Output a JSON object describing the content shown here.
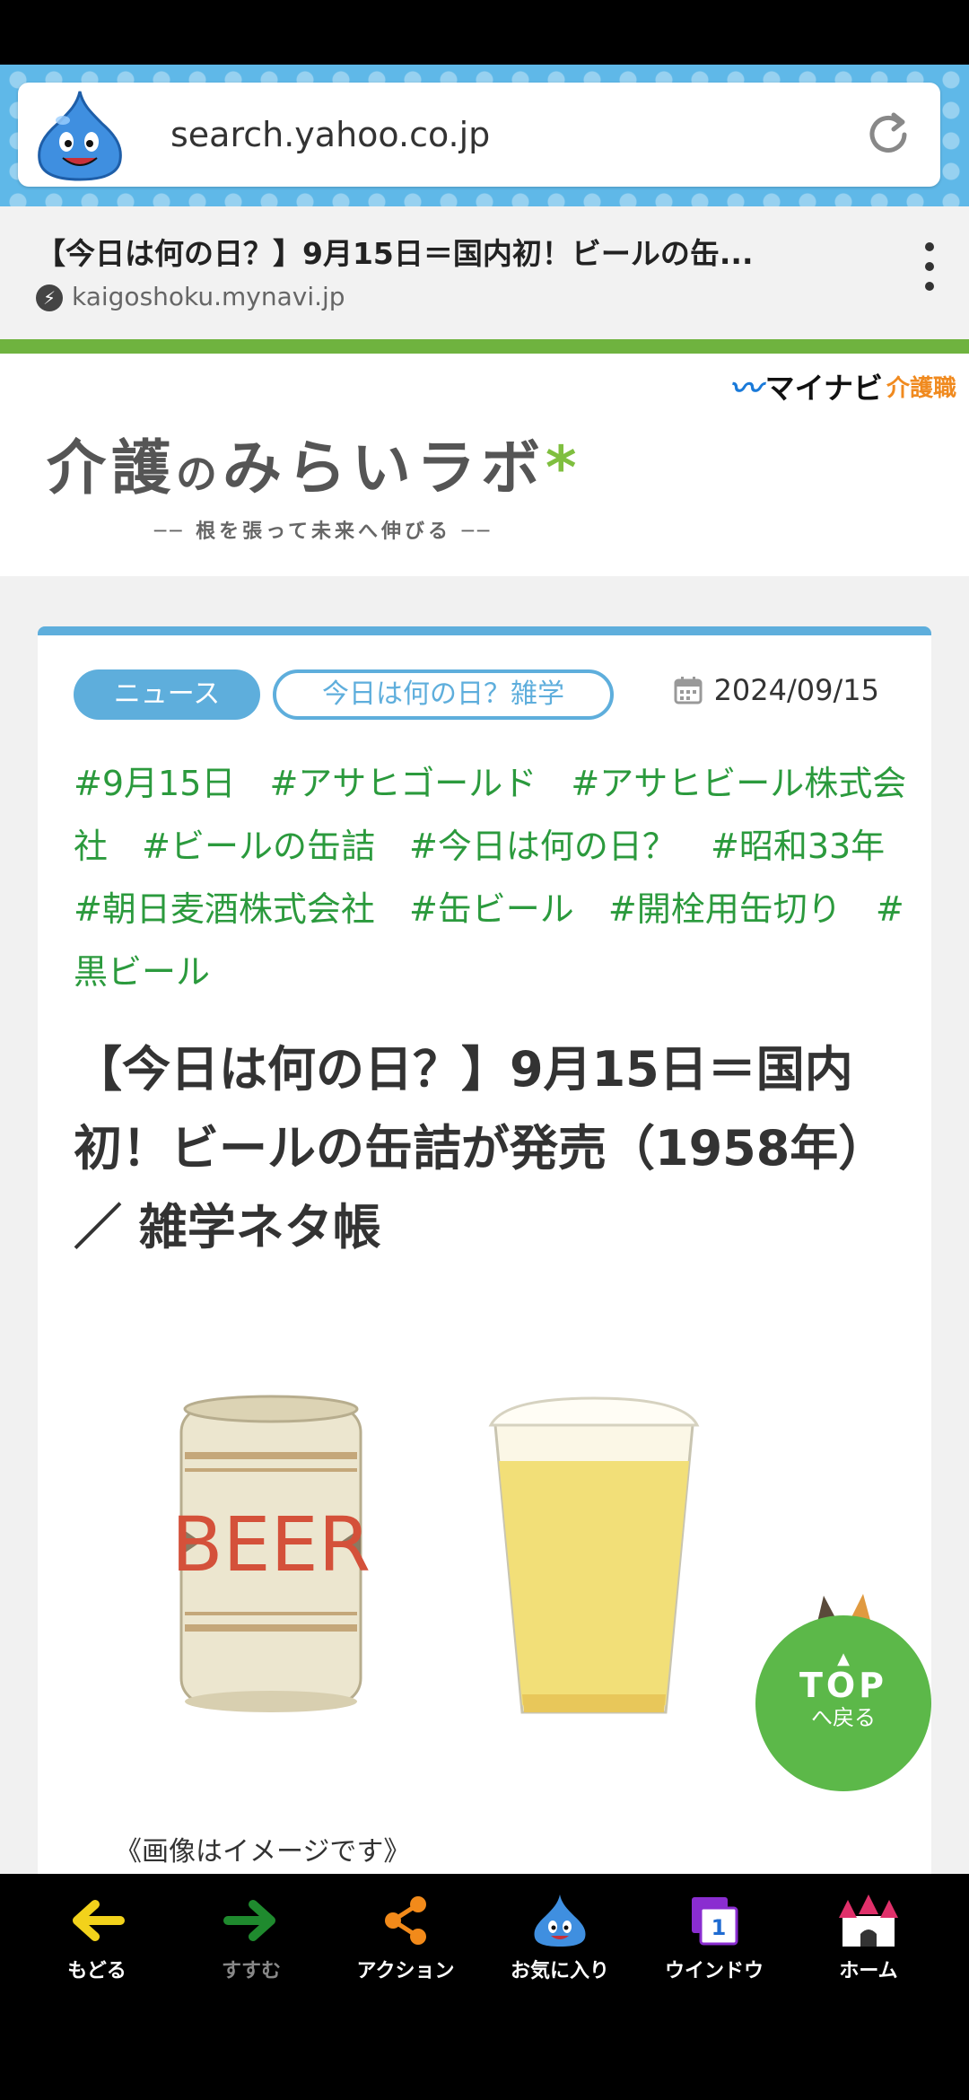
{
  "browser": {
    "url": "search.yahoo.co.jp",
    "page_title": "【今日は何の日？】9月15日＝国内初！ビールの缶...",
    "page_domain": "kaigoshoku.mynavi.jp"
  },
  "site": {
    "partner_logo": "マイナビ",
    "partner_logo_sub": "介護職",
    "logo_main_1": "介護",
    "logo_main_2": "の",
    "logo_main_3": "みらいラボ",
    "logo_tagline": "── 根を張って未来へ伸びる ──"
  },
  "article": {
    "category_primary": "ニュース",
    "category_secondary": "今日は何の日？雑学",
    "date": "2024/09/15",
    "tags": [
      "#9月15日",
      "#アサヒゴールド",
      "#アサヒビール株式会社",
      "#ビールの缶詰",
      "#今日は何の日？",
      "#昭和33年",
      "#朝日麦酒株式会社",
      "#缶ビール",
      "#開栓用缶切り",
      "#黒ビール"
    ],
    "headline": "【今日は何の日？】9月15日＝国内初！ビールの缶詰が発売（1958年）／ 雑学ネタ帳",
    "image_can_text": "BEER",
    "caption": "《画像はイメージです》"
  },
  "top_button": {
    "label": "TOP",
    "sub_label": "へ戻る"
  },
  "bottom_nav": {
    "back": "もどる",
    "forward": "すすむ",
    "action": "アクション",
    "favorites": "お気に入り",
    "window": "ウインドウ",
    "window_count": "1",
    "home": "ホーム"
  },
  "colors": {
    "accent_blue": "#5eaedc",
    "tag_green": "#2b9a3d",
    "top_button_green": "#5cb849"
  }
}
